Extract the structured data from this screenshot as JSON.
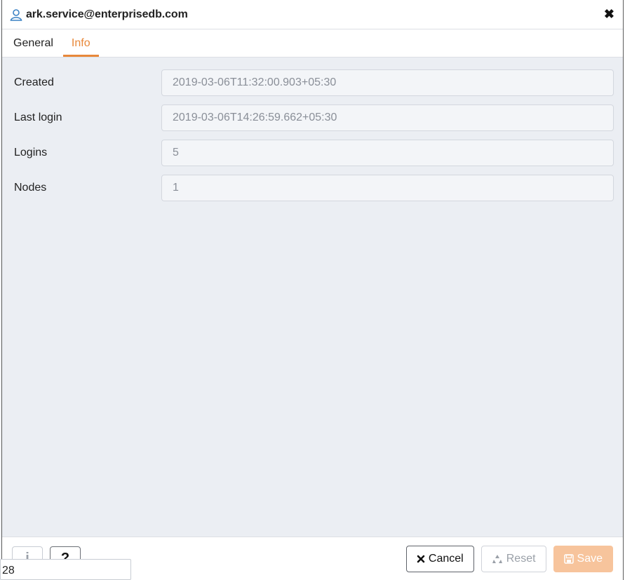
{
  "dialog": {
    "title": "ark.service@enterprisedb.com",
    "close_glyph": "✖"
  },
  "tabs": [
    {
      "label": "General",
      "active": false
    },
    {
      "label": "Info",
      "active": true
    }
  ],
  "fields": [
    {
      "label": "Created",
      "value": "2019-03-06T11:32:00.903+05:30"
    },
    {
      "label": "Last login",
      "value": "2019-03-06T14:26:59.662+05:30"
    },
    {
      "label": "Logins",
      "value": "5"
    },
    {
      "label": "Nodes",
      "value": "1"
    }
  ],
  "footer": {
    "info_glyph": "i",
    "help_glyph": "?",
    "cancel_label": "Cancel",
    "reset_label": "Reset",
    "save_label": "Save"
  },
  "tooltip": {
    "text": "28"
  },
  "colors": {
    "accent": "#e8883a",
    "content_bg": "#ebeef3",
    "save_disabled": "#f7c49c",
    "user_icon": "#3b82c4"
  }
}
